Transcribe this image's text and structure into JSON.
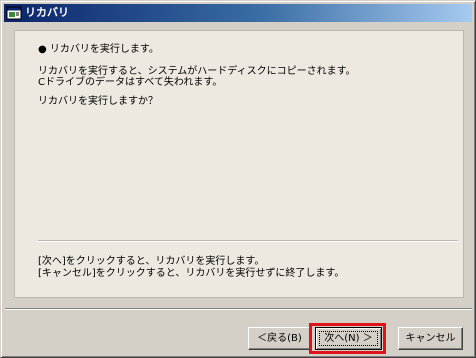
{
  "window": {
    "title": "リカバリ",
    "icon": "app-window-icon"
  },
  "content": {
    "heading": "● リカバリを実行します。",
    "description_line1": "リカバリを実行すると、システムがハードディスクにコピーされます。",
    "description_line2": "Cドライブのデータはすべて失われます。",
    "question": "リカバリを実行しますか？",
    "instruction_line1": "[次へ]をクリックすると、リカバリを実行します。",
    "instruction_line2": "[キャンセル]をクリックすると、リカバリを実行せずに終了します。"
  },
  "buttons": {
    "back": "＜戻る(B)",
    "next": "次へ(N) ＞",
    "cancel": "キャンセル"
  },
  "colors": {
    "titlebar_start": "#0a246a",
    "titlebar_end": "#a6caf0",
    "dialog_face": "#d4d0c8",
    "highlight": "#e0121a"
  }
}
